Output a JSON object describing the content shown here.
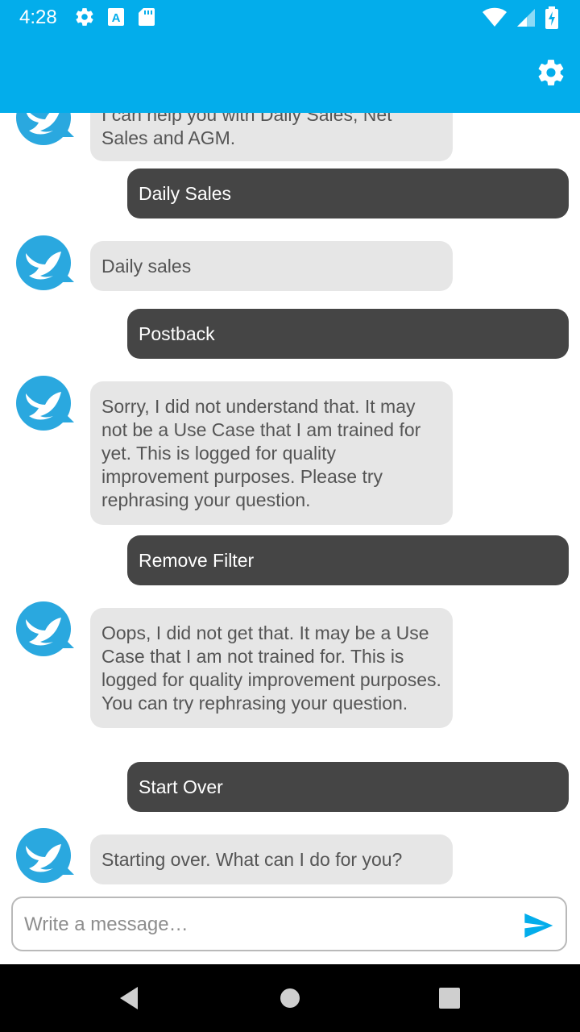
{
  "status_bar": {
    "time": "4:28",
    "left_icons": [
      "gear-icon",
      "a-badge-icon",
      "sd-card-icon"
    ],
    "right_icons": [
      "wifi-icon",
      "signal-icon",
      "battery-charging-icon"
    ]
  },
  "app_bar": {
    "settings_icon": "gear-icon",
    "background": "#03adeb"
  },
  "messages": [
    {
      "role": "bot",
      "text": "I can help you with Daily Sales, Net Sales and AGM."
    },
    {
      "role": "user",
      "text": "Daily Sales"
    },
    {
      "role": "bot",
      "text": "Daily sales"
    },
    {
      "role": "user",
      "text": "Postback"
    },
    {
      "role": "bot",
      "text": "Sorry, I did not understand that. It may not be a Use Case that I am trained for yet. This is logged for quality improvement purposes. Please try rephrasing your question."
    },
    {
      "role": "user",
      "text": "Remove Filter"
    },
    {
      "role": "bot",
      "text": "Oops, I did not get that. It may be a Use Case that I am not trained for. This is logged for quality improvement purposes. You can try rephrasing your question."
    },
    {
      "role": "user",
      "text": "Start Over"
    },
    {
      "role": "bot",
      "text": "Starting over. What can I do for you?"
    }
  ],
  "composer": {
    "placeholder": "Write a message…",
    "send_icon": "send-icon"
  },
  "colors": {
    "accent": "#03adeb",
    "user_bubble": "#454545",
    "bot_bubble": "#e6e6e6"
  },
  "nav_bar": {
    "buttons": [
      "back-icon",
      "home-icon",
      "recents-icon"
    ]
  }
}
